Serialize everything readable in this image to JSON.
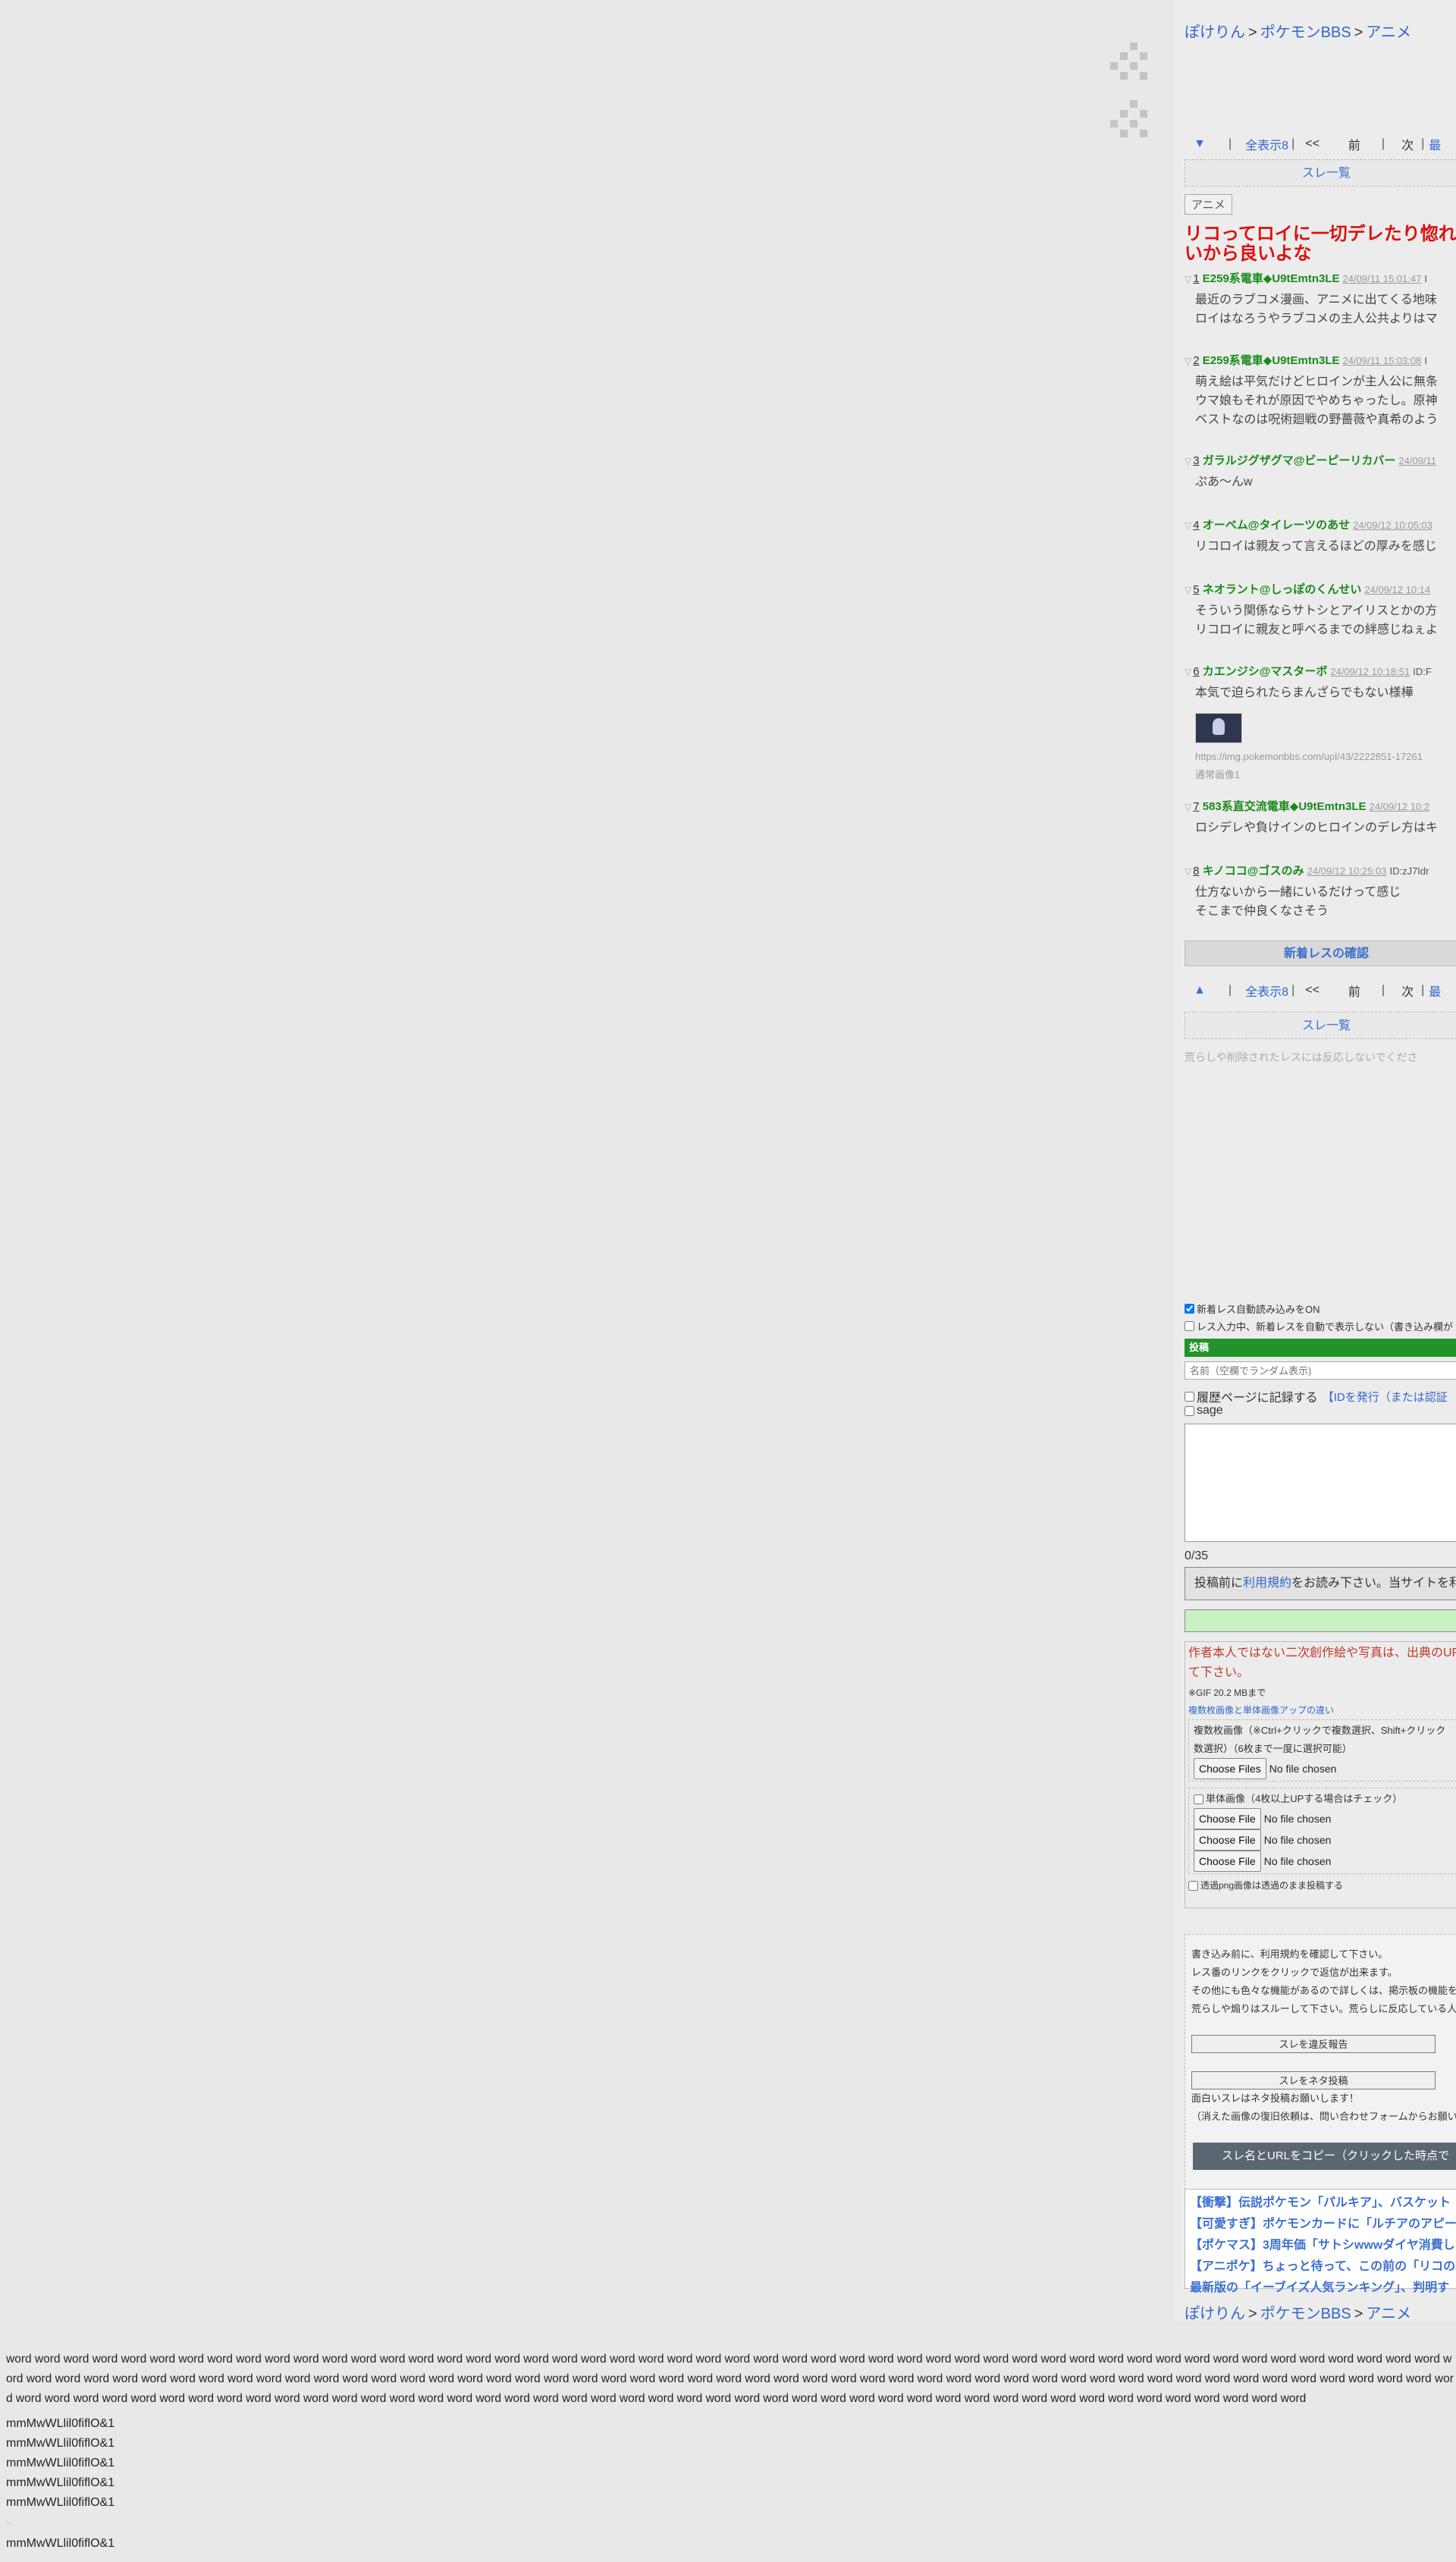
{
  "breadcrumb": {
    "site": "ぽけりん",
    "board": "ポケモンBBS",
    "category": "アニメ",
    "sep": ">"
  },
  "nav": {
    "show_all": "全表示8",
    "first": "<<",
    "prev": "前",
    "next": "次",
    "last": "最"
  },
  "thread_list": "スレ一覧",
  "category_tag": "アニメ",
  "thread_title": [
    "リコってロイに一切デレたり惚れたり",
    "いから良いよな"
  ],
  "posts": [
    {
      "no": "1",
      "name": "E259系電車◆U9tEmtn3LE",
      "date": "24/09/11 15:01:47",
      "id": "I",
      "lines": [
        "最近のラブコメ漫画、アニメに出てくる地味",
        "ロイはなろうやラブコメの主人公共よりはマ"
      ]
    },
    {
      "no": "2",
      "name": "E259系電車◆U9tEmtn3LE",
      "date": "24/09/11 15:03:08",
      "id": "I",
      "lines": [
        "萌え絵は平気だけどヒロインが主人公に無条",
        "ウマ娘もそれが原因でやめちゃったし。原神",
        "ベストなのは呪術廻戦の野薔薇や真希のよう"
      ]
    },
    {
      "no": "3",
      "name": "ガラルジグザグマ@ビーピーリカバー",
      "date": "24/09/11",
      "id": "",
      "lines": [
        "ぷあ〜んw"
      ]
    },
    {
      "no": "4",
      "name": "オーベム@タイレーツのあせ",
      "date": "24/09/12 10:05:03",
      "id": "",
      "lines": [
        "リコロイは親友って言えるほどの厚みを感じ"
      ]
    },
    {
      "no": "5",
      "name": "ネオラント@しっぽのくんせい",
      "date": "24/09/12 10:14",
      "id": "",
      "lines": [
        "そういう関係ならサトシとアイリスとかの方",
        "リコロイに親友と呼べるまでの絆感じねぇよ"
      ]
    },
    {
      "no": "6",
      "name": "カエンジシ@マスターボ",
      "date": "24/09/12 10:18:51",
      "id": "ID:F",
      "lines": [
        "本気で迫られたらまんざらでもない様樺"
      ],
      "image_url": "https://img.pokemonbbs.com/upl/43/2222851-17261",
      "image_caption": "通常画像1"
    },
    {
      "no": "7",
      "name": "583系直交流電車◆U9tEmtn3LE",
      "date": "24/09/12 10:2",
      "id": "",
      "lines": [
        "ロシデレや負けインのヒロインのデレ方はキ"
      ]
    },
    {
      "no": "8",
      "name": "キノココ@ゴスのみ",
      "date": "24/09/12 10:25:03",
      "id": "ID:zJ7Idr",
      "lines": [
        "仕方ないから一緒にいるだけって感じ",
        "そこまで仲良くなさそう"
      ]
    }
  ],
  "new_post_confirm": "新着レスの確認",
  "troll_note": "荒らしや削除されたレスには反応しないでくださ",
  "form": {
    "auto_load": "新着レス自動読み込みをON",
    "no_show_while_typing": "レス入力中、新着レスを自動で表示しない（書き込み欄が",
    "post_header": "投稿",
    "name_placeholder": "名前（空欄でランダム表示)",
    "history_label": "履歴ページに記録する",
    "id_link": "【IDを発行（または認証",
    "sage": "sage",
    "count": "0/35",
    "rules_prefix": "投稿前に",
    "rules_link": "利用規約",
    "rules_suffix": "をお読み下さい。当サイトを利",
    "warn": [
      "作者本人ではない二次創作絵や写真は、出典のUR",
      "て下さい。"
    ],
    "gif_limit": "※GIF 20.2 MBまで",
    "multi_vs_single": "複数枚画像と単体画像アップの違い",
    "multi_label": [
      "複数枚画像（※Ctrl+クリックで複数選択、Shift+クリック",
      "数選択）（6枚まで一度に選択可能）"
    ],
    "choose_files": "Choose Files",
    "choose_file": "Choose File",
    "no_file": "No file chosen",
    "single_label": "単体画像（4枚以上UPする場合はチェック）",
    "png_label": "透過png画像は透過のまま投稿する"
  },
  "info": {
    "lines": [
      "書き込み前に、利用規約を確認して下さい。",
      "レス番のリンクをクリックで返信が出来ます。",
      "その他にも色々な機能があるので詳しくは、掲示板の機能を",
      "荒らしや煽りはスルーして下さい。荒らしに反応している人"
    ],
    "report_btn": "スレを違反報告",
    "neta_btn": "スレをネタ投稿",
    "neta_note": [
      "面白いスレはネタ投稿お願いします！",
      "（消えた画像の復旧依頼は、問い合わせフォームからお願い"
    ],
    "copy_btn": "スレ名とURLをコピー（クリックした時点で"
  },
  "related": [
    "【衝撃】伝説ポケモン「パルキア」、バスケット",
    "【可愛すぎ】ポケモンカードに「ルチアのアピー",
    "【ポケマス】3周年価「サトシwwwダイヤ消費し",
    "【アニポケ】ちょっと待って、この前の「リコの",
    "最新版の「イーブイズ人気ランキング」、判明す"
  ],
  "filler": {
    "words": "word word word word word word word word word word word word word word word word word word word word word word word word word word word word word word word word word word word word word word word word word word word word word word word word word word word word word word word word word word word word word word word word word word word word word word word word word word word word word word word word word word word word word word word word word word word word word word word word word word word word word word word word word word word word word word word word word word word word word word word word word word word word word word word word word word word word word word word word word word word word word word word word word word",
    "mm": [
      "mmMwWLlil0fiflO&1",
      "mmMwWLlil0fiflO&1",
      "mmMwWLlil0fiflO&1",
      "mmMwWLlil0fiflO&1",
      "mmMwWLlil0fiflO&1",
      "mmMwWLlil0fiflO&1"
    ],
    "dots": ".."
  }
}
